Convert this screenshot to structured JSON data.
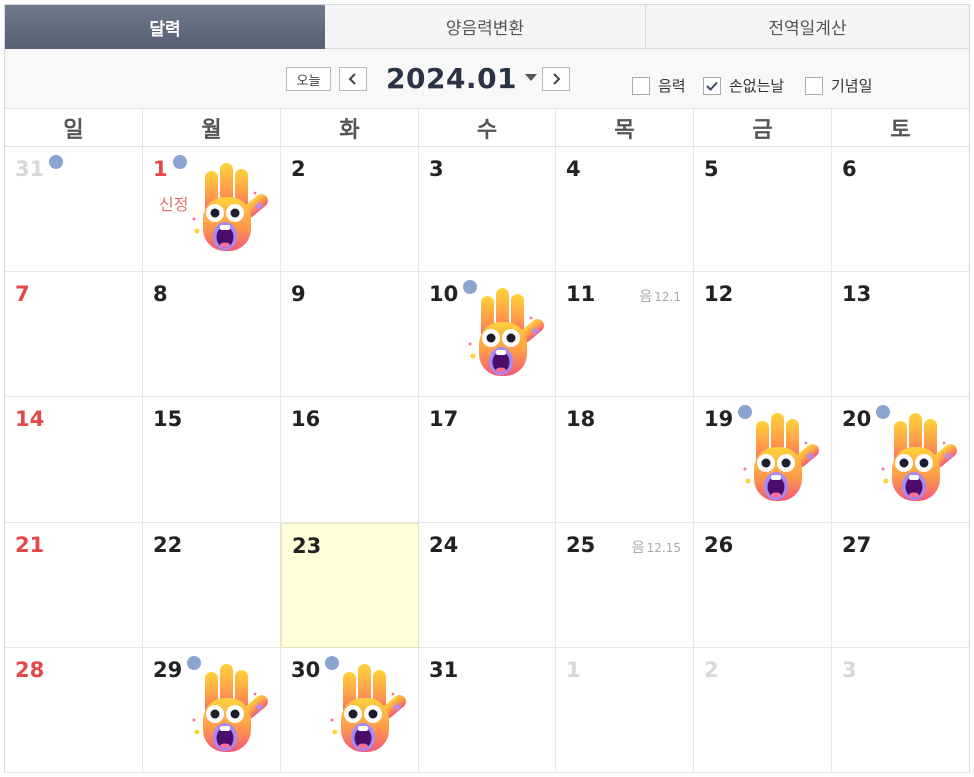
{
  "tabs": [
    {
      "label": "달력",
      "active": true
    },
    {
      "label": "양음력변환",
      "active": false
    },
    {
      "label": "전역일계산",
      "active": false
    }
  ],
  "toolbar": {
    "today_label": "오늘",
    "month_title": "2024.01",
    "options": [
      {
        "label": "음력",
        "checked": false
      },
      {
        "label": "손없는날",
        "checked": true
      },
      {
        "label": "기념일",
        "checked": false
      }
    ]
  },
  "weekdays": [
    "일",
    "월",
    "화",
    "수",
    "목",
    "금",
    "토"
  ],
  "colors": {
    "accent": "#556173",
    "sunday": "#e54848",
    "today_bg": "#ffffd9",
    "dot": "#8aa4cf"
  },
  "days": [
    {
      "num": "31",
      "other": true,
      "dot": true
    },
    {
      "num": "1",
      "dot": true,
      "holiday": "신정",
      "hand": true
    },
    {
      "num": "2"
    },
    {
      "num": "3"
    },
    {
      "num": "4"
    },
    {
      "num": "5"
    },
    {
      "num": "6"
    },
    {
      "num": "7"
    },
    {
      "num": "8"
    },
    {
      "num": "9"
    },
    {
      "num": "10",
      "dot": true,
      "hand": true
    },
    {
      "num": "11",
      "lunar": "음",
      "lunar_date": "12.1"
    },
    {
      "num": "12"
    },
    {
      "num": "13"
    },
    {
      "num": "14"
    },
    {
      "num": "15"
    },
    {
      "num": "16"
    },
    {
      "num": "17"
    },
    {
      "num": "18"
    },
    {
      "num": "19",
      "dot": true,
      "hand": true
    },
    {
      "num": "20",
      "dot": true,
      "hand": true
    },
    {
      "num": "21"
    },
    {
      "num": "22"
    },
    {
      "num": "23",
      "today": true
    },
    {
      "num": "24"
    },
    {
      "num": "25",
      "lunar": "음",
      "lunar_date": "12.15"
    },
    {
      "num": "26"
    },
    {
      "num": "27"
    },
    {
      "num": "28"
    },
    {
      "num": "29",
      "dot": true,
      "hand": true
    },
    {
      "num": "30",
      "dot": true,
      "hand": true
    },
    {
      "num": "31"
    },
    {
      "num": "1",
      "other": true
    },
    {
      "num": "2",
      "other": true
    },
    {
      "num": "3",
      "other": true
    }
  ]
}
